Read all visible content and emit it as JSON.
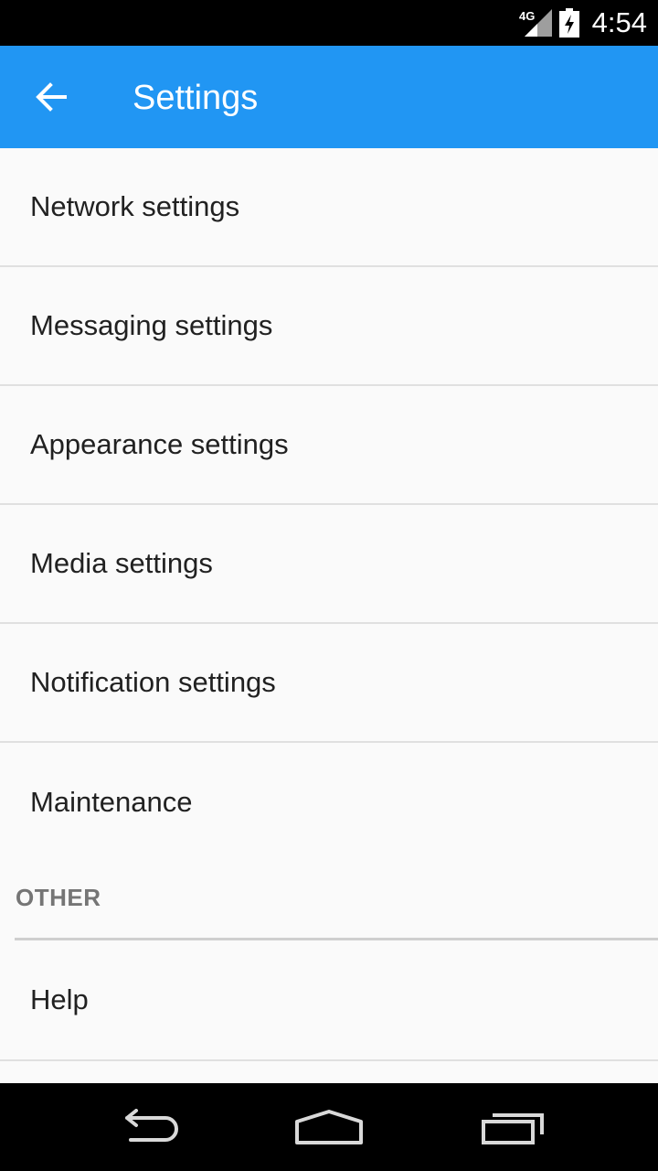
{
  "status_bar": {
    "network": "4G",
    "time": "4:54",
    "icons": [
      "signal-icon",
      "battery-charging-icon"
    ]
  },
  "app_bar": {
    "title": "Settings",
    "back_icon": "arrow-left-icon",
    "color": "#2196f3"
  },
  "items": [
    {
      "label": "Network settings"
    },
    {
      "label": "Messaging settings"
    },
    {
      "label": "Appearance settings"
    },
    {
      "label": "Media settings"
    },
    {
      "label": "Notification settings"
    },
    {
      "label": "Maintenance"
    }
  ],
  "section_other": {
    "header": "OTHER",
    "items": [
      {
        "label": "Help"
      }
    ]
  },
  "nav_bar": {
    "icons": [
      "back-nav-icon",
      "home-nav-icon",
      "recents-nav-icon"
    ]
  }
}
